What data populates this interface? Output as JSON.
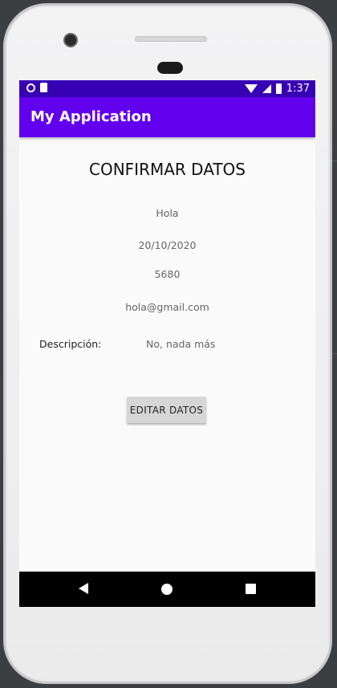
{
  "statusbar": {
    "time": "1:37"
  },
  "appbar": {
    "title": "My Application"
  },
  "content": {
    "title": "CONFIRMAR DATOS",
    "name": "Hola",
    "date": "20/10/2020",
    "number": "5680",
    "email": "hola@gmail.com",
    "description_label": "Descripción:",
    "description_value": "No, nada más"
  },
  "actions": {
    "edit_label": "EDITAR DATOS"
  },
  "colors": {
    "statusbar": "#3700b3",
    "appbar": "#6200ee",
    "background": "#fafafa"
  },
  "icons": {
    "status_left": [
      "notification-dot-icon",
      "sd-card-icon"
    ],
    "status_right": [
      "wifi-icon",
      "signal-icon",
      "battery-icon"
    ],
    "nav": [
      "back-icon",
      "home-icon",
      "recents-icon"
    ]
  }
}
